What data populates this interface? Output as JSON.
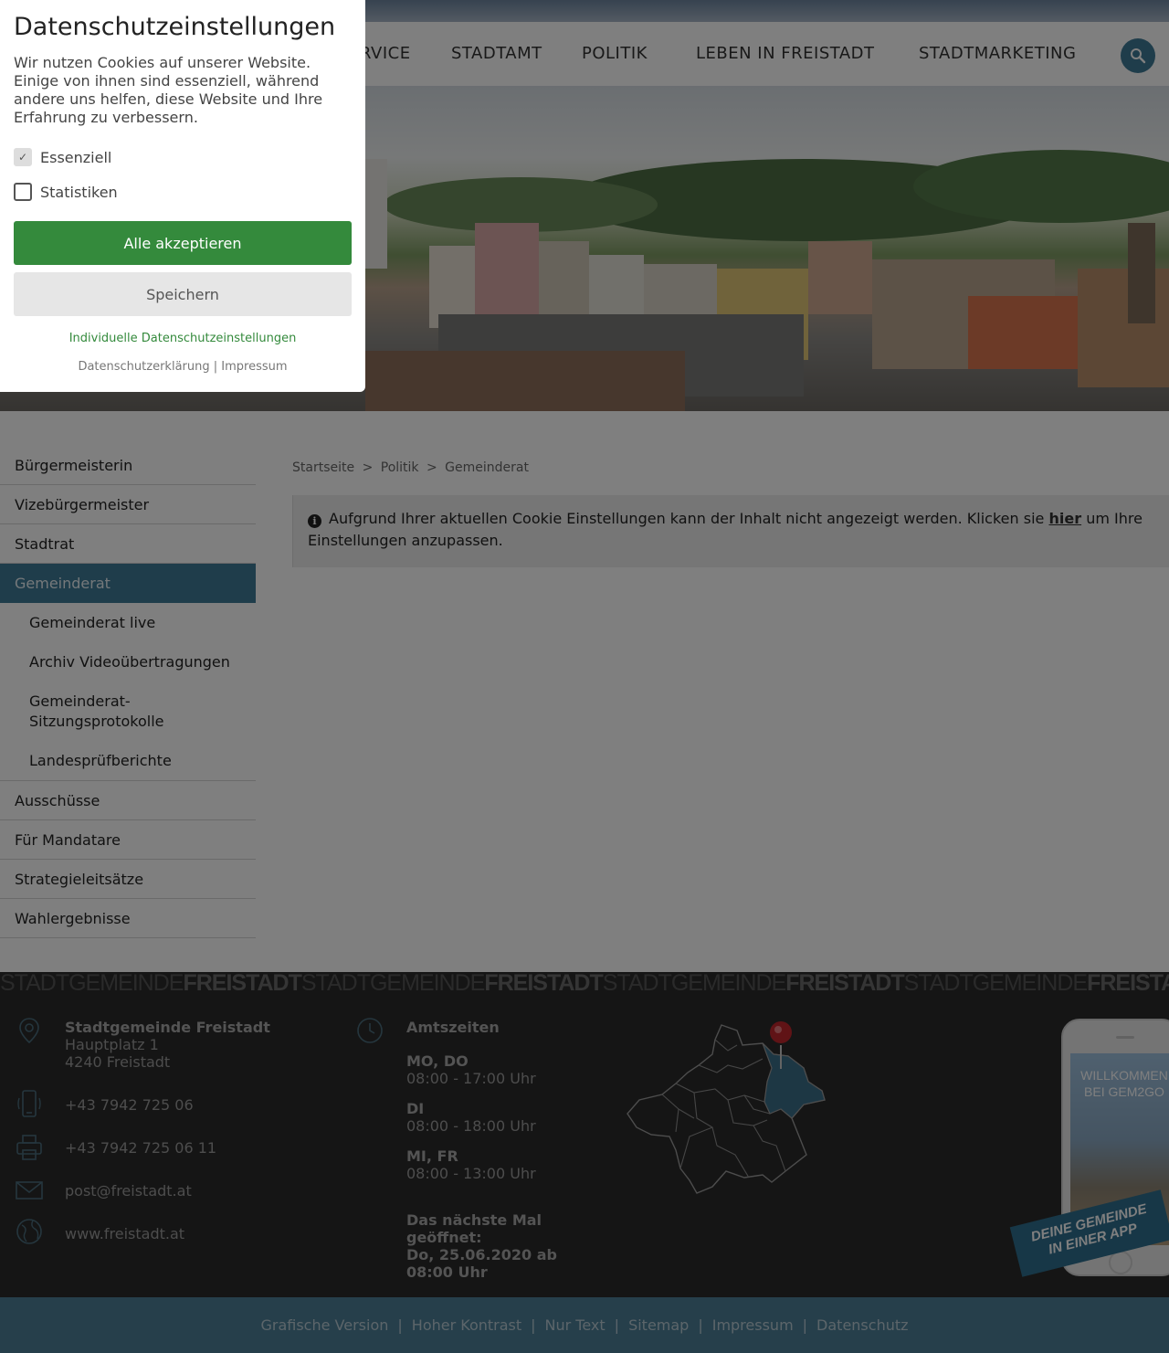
{
  "nav": {
    "items": [
      "RVICE",
      "STADTAMT",
      "POLITIK",
      "LEBEN IN FREISTADT",
      "STADTMARKETING"
    ]
  },
  "sidebar": {
    "items": [
      {
        "label": "Bürgermeisterin"
      },
      {
        "label": "Vizebürgermeister"
      },
      {
        "label": "Stadtrat"
      },
      {
        "label": "Gemeinderat",
        "active": true
      },
      {
        "label": "Ausschüsse"
      },
      {
        "label": "Für Mandatare"
      },
      {
        "label": "Strategieleitsätze"
      },
      {
        "label": "Wahlergebnisse"
      }
    ],
    "subitems": [
      "Gemeinderat live",
      "Archiv Videoübertragungen",
      "Gemeinderat-Sitzungsprotokolle",
      "Landesprüfberichte"
    ]
  },
  "breadcrumb": [
    "Startseite",
    "Politik",
    "Gemeinderat"
  ],
  "breadcrumb_sep": ">",
  "notice": {
    "text_before": "Aufgrund Ihrer aktuellen Cookie Einstellungen kann der Inhalt nicht angezeigt werden. Klicken sie",
    "link": "hier",
    "text_after": "um Ihre Einstellungen anzupassen."
  },
  "footer": {
    "band_light": "STADTGEMEINDE",
    "band_bold": "FREISTADT",
    "org_name": "Stadtgemeinde Freistadt",
    "street": "Hauptplatz 1",
    "city": "4240 Freistadt",
    "phone": "+43 7942 725 06",
    "fax": "+43 7942 725 06 11",
    "email": "post@freistadt.at",
    "web": "www.freistadt.at",
    "hours_title": "Amtszeiten",
    "hours": [
      {
        "days": "MO, DO",
        "time": "08:00 - 17:00 Uhr"
      },
      {
        "days": "DI",
        "time": "08:00 - 18:00 Uhr"
      },
      {
        "days": "MI, FR",
        "time": "08:00 - 13:00 Uhr"
      }
    ],
    "next_open_1": "Das nächste Mal",
    "next_open_2": "geöffnet:",
    "next_open_3": "Do, 25.06.2020 ab",
    "next_open_4": "08:00 Uhr",
    "app_title": "WILLKOMMEN BEI GEM2GO",
    "app_banner_1": "DEINE GEMEINDE",
    "app_banner_2": "IN EINER APP"
  },
  "bottom_links": [
    "Grafische Version",
    "Hoher Kontrast",
    "Nur Text",
    "Sitemap",
    "Impressum",
    "Datenschutz"
  ],
  "bottom_sep": "|",
  "cookie": {
    "title": "Datenschutzeinstellungen",
    "description": "Wir nutzen Cookies auf unserer Website. Einige von ihnen sind essenziell, während andere uns helfen, diese Website und Ihre Erfahrung zu verbessern.",
    "options": [
      {
        "label": "Essenziell",
        "checked": true
      },
      {
        "label": "Statistiken",
        "checked": false
      }
    ],
    "accept_label": "Alle akzeptieren",
    "save_label": "Speichern",
    "individual_label": "Individuelle Datenschutzeinstellungen",
    "privacy_label": "Datenschutzerklärung",
    "sep": "|",
    "imprint_label": "Impressum"
  },
  "colors": {
    "accent": "#3f7a96",
    "accept": "#348a3c",
    "footer_bg": "#2b2b2b",
    "bottom_bar": "#4d7f96"
  }
}
